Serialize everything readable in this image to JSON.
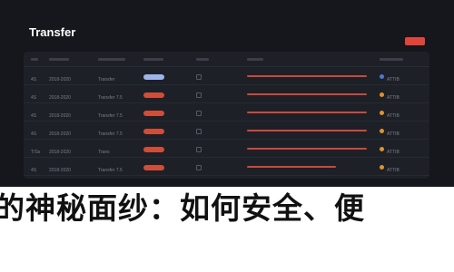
{
  "window": {
    "title": "Transfer"
  },
  "colors": {
    "background": "#15171c",
    "panel": "#1d2027",
    "accent_red": "#cf4e3a",
    "accent_blue": "#9fb4e8",
    "status_orange": "#e0922f",
    "status_blue": "#4c78d6"
  },
  "table": {
    "rows": [
      {
        "id": "4S",
        "date": "2018-2020",
        "name": "Transfer",
        "status_pill": "blue",
        "state_dot": "blue",
        "state": "ATTIB",
        "bar_fill": 0.95
      },
      {
        "id": "4S",
        "date": "2018-2020",
        "name": "Transfer 7.5",
        "status_pill": "red",
        "state_dot": "orange",
        "state": "ATTIB",
        "bar_fill": 0.95
      },
      {
        "id": "4S",
        "date": "2018-2020",
        "name": "Transfer 7.5",
        "status_pill": "red",
        "state_dot": "orange",
        "state": "ATTIB",
        "bar_fill": 0.95
      },
      {
        "id": "4S",
        "date": "2018-2020",
        "name": "Transfer 7.5",
        "status_pill": "red",
        "state_dot": "orange",
        "state": "ATTIB",
        "bar_fill": 0.95
      },
      {
        "id": "T/Ss",
        "date": "2018-2020",
        "name": "Trans",
        "status_pill": "red",
        "state_dot": "orange",
        "state": "ATTIB",
        "bar_fill": 0.95
      },
      {
        "id": "4S",
        "date": "2018-2020",
        "name": "Transfer 7.5",
        "status_pill": "red",
        "state_dot": "orange",
        "state": "ATTIB",
        "bar_fill": 0.7
      },
      {
        "id": "4S",
        "date": "2018-2020",
        "name": "Transfer 7.5",
        "status_pill": "red",
        "state_dot": "orange",
        "state": "ATTIB",
        "bar_fill": 0.95
      }
    ]
  },
  "banner": {
    "text": "的神秘面纱：如何安全、便"
  }
}
